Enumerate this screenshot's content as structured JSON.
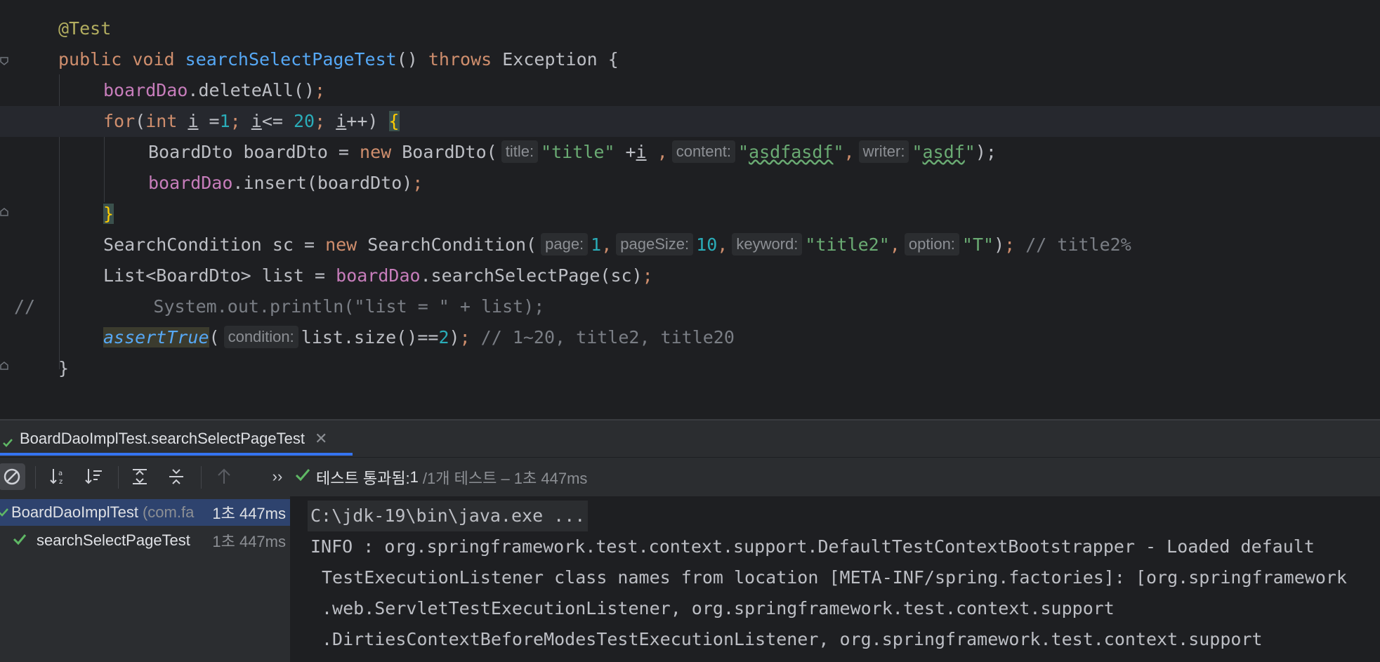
{
  "editor": {
    "lines": [
      {
        "annotation": "@Test"
      },
      {
        "kw_public": "public",
        "kw_void": "void",
        "method": "searchSelectPageTest",
        "paren": "()",
        "kw_throws": "throws",
        "exception": "Exception",
        "brace": "{"
      },
      {
        "field": "boardDao",
        "call": ".deleteAll()",
        "semi": ";"
      },
      {
        "kw_for": "for",
        "open": "(",
        "kw_int": "int",
        "var_i": "i",
        "assign": " =",
        "one": "1",
        "semi1": "; ",
        "cond_i": "i",
        "le": "<= ",
        "twenty": "20",
        "semi2": "; ",
        "inc_i": "i",
        "inc": "++) ",
        "brace": "{"
      },
      {
        "type": "BoardDto boardDto = ",
        "kw_new": "new",
        "ctor": " BoardDto(",
        "hint_title": "title:",
        "str_title": "\"title\"",
        "plus": " +",
        "var_i": "i",
        "comma1": " ,",
        "hint_content": "content:",
        "str_content_q1": "\"",
        "str_content": "asdfasdf",
        "str_content_q2": "\"",
        "comma2": ",",
        "hint_writer": "writer:",
        "str_writer_q1": "\"",
        "str_writer": "asdf",
        "str_writer_q2": "\"",
        "close": ");"
      },
      {
        "field": "boardDao",
        "call": ".insert(boardDto)",
        "semi": ";"
      },
      {
        "brace": "}"
      },
      {
        "type": "SearchCondition sc = ",
        "kw_new": "new",
        "ctor": " SearchCondition(",
        "hint_page": "page:",
        "num_page": "1",
        "c1": ",",
        "hint_pagesize": "pageSize:",
        "num_pagesize": "10",
        "c2": ",",
        "hint_keyword": "keyword:",
        "str_keyword": "\"title2\"",
        "c3": ",",
        "hint_option": "option:",
        "str_option": "\"T\"",
        "close": ")",
        "semi": ";",
        "comment": " // title2%"
      },
      {
        "type": "List<BoardDto> list = ",
        "field": "boardDao",
        "call": ".searchSelectPage(sc)",
        "semi": ";"
      },
      {
        "comment_prefix": "//",
        "comment_body": "      System.out.println(\"list = \" + list);"
      },
      {
        "method": "assertTrue",
        "open": "(",
        "hint_condition": "condition:",
        "expr": "list.size()==",
        "num": "2",
        "close": ")",
        "semi": ";",
        "comment": " // 1~20, title2, title20"
      },
      {
        "brace": "}"
      }
    ]
  },
  "run_tab": {
    "label": "BoardDaoImplTest.searchSelectPageTest",
    "close": "✕"
  },
  "toolbar": {
    "more": "››",
    "status_label": "테스트 통과됨:",
    "status_count": " 1",
    "status_detail": "/1개 테스트 – 1초 447ms"
  },
  "tree": {
    "rows": [
      {
        "name": "BoardDaoImplTest",
        "pkg": "(com.fa",
        "time": "1초 447ms"
      },
      {
        "name": "searchSelectPageTest",
        "time": "1초 447ms"
      }
    ]
  },
  "console": {
    "lines": [
      "C:\\jdk-19\\bin\\java.exe ...",
      "INFO : org.springframework.test.context.support.DefaultTestContextBootstrapper - Loaded default",
      "TestExecutionListener class names from location [META-INF/spring.factories]: [org.springframework",
      ".web.ServletTestExecutionListener, org.springframework.test.context.support",
      ".DirtiesContextBeforeModesTestExecutionListener, org.springframework.test.context.support"
    ]
  },
  "colors": {
    "pass_green": "#5fb865",
    "accent_blue": "#3574f0"
  },
  "icons": [
    "fold-marker-icon",
    "check-icon",
    "stop-icon",
    "sort-alpha-icon",
    "sort-duration-icon",
    "expand-all-icon",
    "collapse-all-icon",
    "up-arrow-icon",
    "more-icon"
  ]
}
